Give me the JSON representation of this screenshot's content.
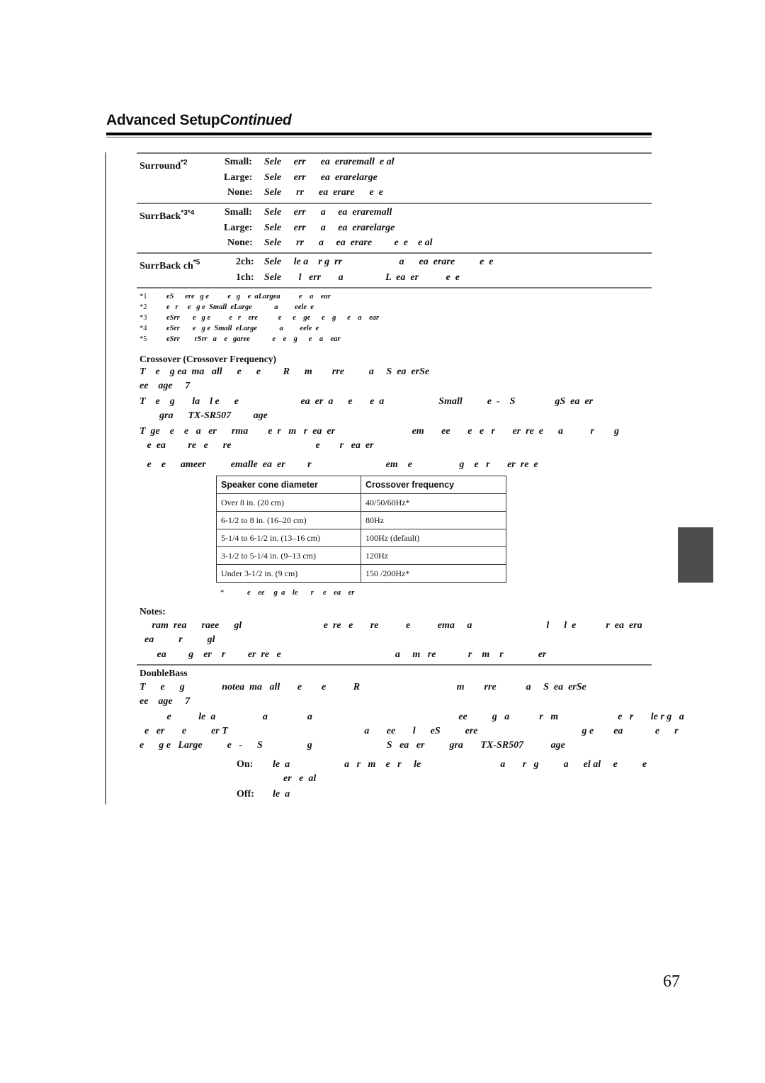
{
  "header": {
    "title": "Advanced Setup",
    "title_suffix": "Continued"
  },
  "speaker_settings": [
    {
      "label": "Surround",
      "note": "*2",
      "options": [
        {
          "name": "Small:",
          "text": "Sele     err      ea  eraremall  e al"
        },
        {
          "name": "Large:",
          "text": "Sele     err      ea  erarelarge"
        },
        {
          "name": "None:",
          "text": "Sele      rr      ea  erare      e  e"
        }
      ]
    },
    {
      "label": "SurrBack",
      "note": "*3*4",
      "options": [
        {
          "name": "Small:",
          "text": "Sele     err      a     ea  eraremall"
        },
        {
          "name": "Large:",
          "text": "Sele     err      a     ea  erarelarge"
        },
        {
          "name": "None:",
          "text": "Sele      rr      a     ea  erare         e  e    e al"
        }
      ]
    },
    {
      "label": "SurrBack ch",
      "note": "*5",
      "options": [
        {
          "name": "2ch:",
          "text": "Sele     le a    r g  rr                       a      ea  erare          e  e"
        },
        {
          "name": "1ch:",
          "text": "Sele       l   err       a                 L  ea  er           e  e"
        }
      ]
    }
  ],
  "footnotes": [
    {
      "mark": "*1",
      "text": "eS      ere   g e          e   g    e  aLargea          e    a    ear"
    },
    {
      "mark": "*2",
      "text": "e   r     e   g e  Small  eLarge            a         eele  e"
    },
    {
      "mark": "*3",
      "text": "eSrr       e   g e          e   r    ere           e      e    ge      e    g      e    a    ear"
    },
    {
      "mark": "*4",
      "text": "eSrr       e   g e  Small  eLarge            a         eele  e"
    },
    {
      "mark": "*5",
      "text": "eSrr        rSrr   a    e   garee            e    e    g      e    a    ear"
    }
  ],
  "crossover": {
    "heading": "Crossover (Crossover Frequency)",
    "paragraphs": [
      "T    e    g ea  ma   all      e      e         R      m        rre          a     S  ea  erSe",
      "ee    age     7",
      "T    e    g       la    l e      e                         ea  er  a      e       e  a                      Small          e  -    S                gS  ea  er",
      "        gra      TX-SR507         age",
      "T  ge    e    e   a   er      rma        e  r   m   r  ea  er                               em       ee       e   e   r       er  re  e      a           r        g",
      "   e  ea         re   e      re                                  e        r   ea  er",
      "   e    e      ameer          emalle  ea  er         r                              em    e                   g    e   r       er  re  e"
    ],
    "table": {
      "headers": [
        "Speaker cone diameter",
        "Crossover frequency"
      ],
      "rows": [
        [
          "Over 8 in. (20 cm)",
          "40/50/60Hz*"
        ],
        [
          "6-1/2 to 8 in. (16–20 cm)",
          "80Hz"
        ],
        [
          "5-1/4 to 6-1/2 in. (13–16 cm)",
          "100Hz (default)"
        ],
        [
          "3-1/2 to 5-1/4 in. (9–13 cm)",
          "120Hz"
        ],
        [
          "Under 3-1/2 in. (9 cm)",
          "150 /200Hz*"
        ]
      ],
      "footnote_mark": "*",
      "footnote": "e    ee     g  a    le       r     e    ea    er"
    }
  },
  "notes": {
    "heading": "Notes:",
    "lines": [
      "     ram  rea      raee      gl                                 e  re   e       re           e           ema     a                              l      l  e            r  ea  era",
      "  ea          r          gl",
      "       ea         g    er    r         er  re   e                                              a     m   re             r    m    r              er"
    ]
  },
  "doublebass": {
    "heading": "DoubleBass",
    "paragraphs": [
      "T      e      g               notea  ma   all       e        e           R                                       m        rre            a     S  ea  erSe",
      "ee    age     7",
      "           e           le  a                   a                a                                                           ee          g   a            r   m                        e   r       le r g   a",
      "  e   er       e          er T                                                       a       ee       l      eS          ere                                          g e        ea             e      r",
      "e      g e   Large          e   -      S                  g                              S   ea   er          gra       TX-SR507           age"
    ],
    "options": [
      {
        "name": "On:",
        "text": "le  a                      a   r   m    e   r     le                                a       r   g          a      el al     e          e",
        "cont": "er   e  al"
      },
      {
        "name": "Off:",
        "text": "le  a"
      }
    ]
  },
  "page_number": "67"
}
